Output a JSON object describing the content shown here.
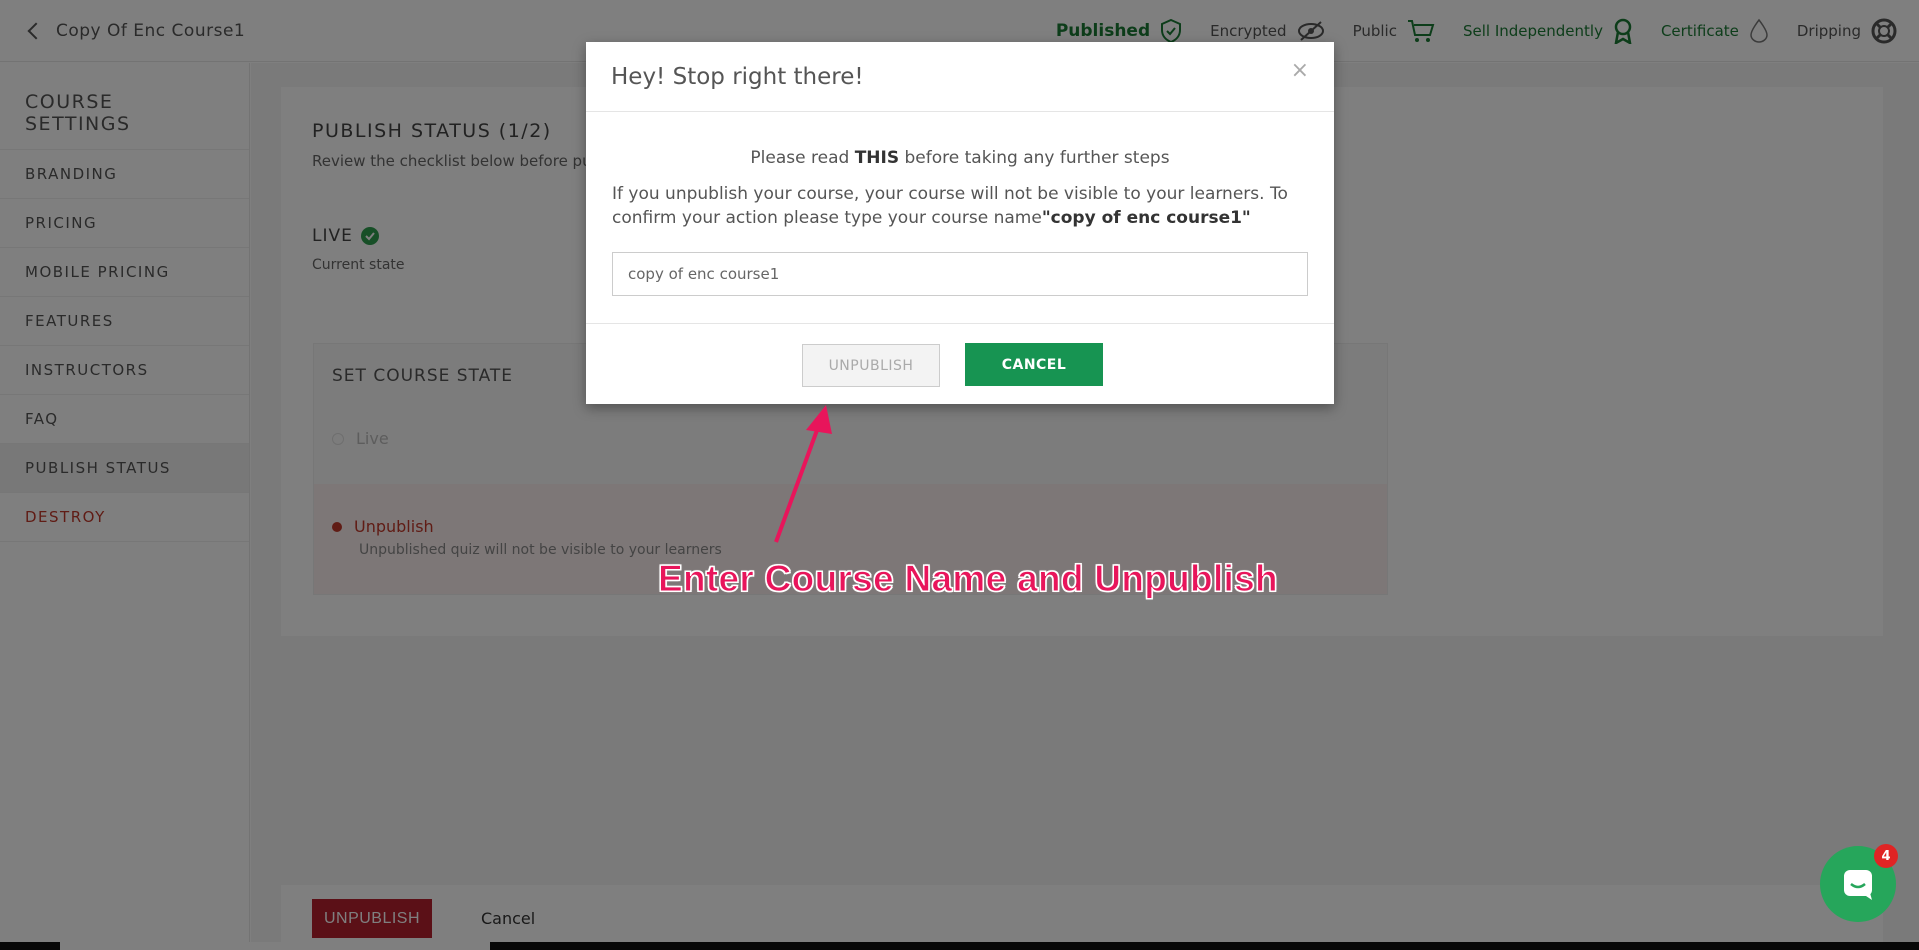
{
  "header": {
    "course_title": "Copy Of Enc Course1",
    "badges": [
      {
        "label": "Published",
        "icon": "shield-check-icon"
      },
      {
        "label": "Encrypted",
        "icon": "eye-slash-icon"
      },
      {
        "label": "Public",
        "icon": "cart-icon"
      },
      {
        "label": "Sell Independently",
        "icon": "ribbon-icon"
      },
      {
        "label": "Certificate",
        "icon": "drop-icon"
      },
      {
        "label": "Dripping",
        "icon": "lifebuoy-icon"
      }
    ]
  },
  "sidebar": {
    "title": "COURSE SETTINGS",
    "items": [
      {
        "label": "BRANDING"
      },
      {
        "label": "PRICING"
      },
      {
        "label": "MOBILE PRICING"
      },
      {
        "label": "FEATURES"
      },
      {
        "label": "INSTRUCTORS"
      },
      {
        "label": "FAQ"
      },
      {
        "label": "PUBLISH STATUS"
      },
      {
        "label": "DESTROY"
      }
    ]
  },
  "main": {
    "heading": "PUBLISH STATUS (1/2)",
    "subheading": "Review the checklist below before pu",
    "live_label": "LIVE",
    "current_state": "Current state",
    "set_state_title": "SET COURSE STATE",
    "option_live": "Live",
    "option_unpublish": "Unpublish",
    "unpublish_desc": "Unpublished quiz will not be visible to your learners"
  },
  "footer": {
    "unpublish_label": "UNPUBLISH",
    "cancel_label": "Cancel"
  },
  "modal": {
    "title": "Hey! Stop right there!",
    "close": "×",
    "line1_pre": "Please read ",
    "line1_bold": "THIS",
    "line1_post": " before taking any further steps",
    "line2_pre": "If you unpublish your course, your course will not be visible to your learners. To confirm your action please type your course name",
    "line2_bold": "\"copy of enc course1\"",
    "input_value": "copy of enc course1",
    "unpublish_label": "UNPUBLISH",
    "cancel_label": "CANCEL"
  },
  "annotation": "Enter Course Name and Unpublish",
  "chat": {
    "badge_count": "4"
  },
  "colors": {
    "brand_green": "#179452",
    "danger_red": "#b7202e",
    "annotation_pink": "#e8155b"
  }
}
